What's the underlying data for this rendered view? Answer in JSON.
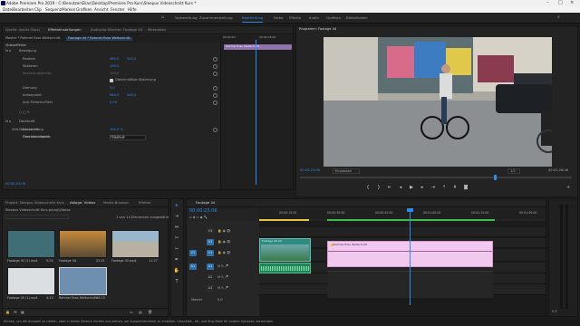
{
  "titlebar": {
    "title": "Adobe Premiere Pro 2019 - C:\\Benutzer\\Elias\\Desktop\\Premiere Pro Kurs\\Sleepus Videoschnitt Kurs *"
  },
  "menu": [
    "Datei",
    "Bearbeiten",
    "Clip",
    "Sequenz",
    "Marken",
    "Grafiken",
    "Ansicht",
    "Fenster",
    "Hilfe"
  ],
  "workspaces": [
    {
      "label": "Vorbereitung",
      "active": false
    },
    {
      "label": "Zusammenstellung",
      "active": false
    },
    {
      "label": "Bearbeitung",
      "active": true
    },
    {
      "label": "Farbe",
      "active": false
    },
    {
      "label": "Effekte",
      "active": false
    },
    {
      "label": "Audio",
      "active": false
    },
    {
      "label": "Grafiken",
      "active": false
    },
    {
      "label": "Bibliotheken",
      "active": false
    }
  ],
  "source_panel": {
    "tabs": [
      "Quelle: (keine Clips)",
      "Effekteinstellungen",
      "Audioclip-Mischer: Footage 44",
      "Metadaten"
    ],
    "breadcrumb_master": "Master * Rahmel Esso Weltschnitt",
    "breadcrumb_clip": "Footage 44 * Rahmel Esso Weltschnitt",
    "section_video": "Videoeffekte",
    "clip_on_timeline": "Rahmel Esso Weltschnitt",
    "timecode_start": "00:00:00",
    "timecode_mid": "00:00:05:00",
    "props": [
      {
        "label": "Bewegung",
        "value": "",
        "value2": ""
      },
      {
        "label": "Position",
        "value": "960,0",
        "value2": "540,0"
      },
      {
        "label": "Skalieren",
        "value": "100,0",
        "value2": ""
      },
      {
        "label": "Skalierungsbreite",
        "value": "100,0",
        "value2": ""
      },
      {
        "label": "",
        "value": "Gleichmäßige Skalierung",
        "value2": ""
      },
      {
        "label": "Drehung",
        "value": "0,0",
        "value2": ""
      },
      {
        "label": "Ankerpunkt",
        "value": "960,0",
        "value2": "540,0"
      },
      {
        "label": "Anti-Flimmer-Filter",
        "value": "0,00",
        "value2": ""
      }
    ],
    "opacity_section": "Deckkraft",
    "opacity_props": [
      {
        "label": "Deckkraft",
        "value": "100,0 %"
      },
      {
        "label": "Überblendmodus",
        "value": "Normal"
      }
    ],
    "time_remap": "Zeit-Neuzuordnung",
    "speed_label": "Geschwindigkeit",
    "speed_value": "100,00 %",
    "bottom_timecode": "00:00:23:06"
  },
  "program": {
    "title": "Programm: Footage 44",
    "timecode": "00:00:23:06",
    "fit": "Einpassen",
    "quality": "1/2",
    "duration": "00:01:28:08"
  },
  "project": {
    "tabs": [
      "Projekt: Sleepus Videoschnitt Kurs",
      "Ablage: Videos",
      "Media-Browser",
      "Effekte"
    ],
    "path": "Sleepus Videoschnitt Kurs.prproj\\Videos",
    "count": "1 von 14 Elementen ausgewählt",
    "items": [
      {
        "name": "Footage 43 (1).mp4",
        "duration": "5:24"
      },
      {
        "name": "Footage 44",
        "duration": "22:21"
      },
      {
        "name": "Footage 45.mp4",
        "duration": "11:27"
      },
      {
        "name": "Footage 45 (1).mp4",
        "duration": "4:13"
      },
      {
        "name": "Rahmel Esso Weltschnitt",
        "duration": "44:13"
      }
    ]
  },
  "timeline": {
    "tab": "Footage 44",
    "timecode": "00:00:23:06",
    "ruler": [
      "00:00:15:00",
      "00:00:30:00",
      "00:00:45:00",
      "00:01:00:00",
      "00:01:15:00",
      "00:01:30:00"
    ],
    "tracks": [
      "V3",
      "V2",
      "V1",
      "A1",
      "A2",
      "A3"
    ],
    "master": "Master",
    "master_value": "0,0",
    "clip_v1": "Footage 44 [V]",
    "clip_v2": "Rahmel Esso Weltschnitt"
  },
  "status": "Klicken, um die Auswahl zu treffen, oder in leeren Bereich klicken und ziehen, um Auswahlrechteck zu erstellen. Umschalt-, Alt- und Strg-Taste für andere Optionen verwenden.",
  "colors": {
    "accent": "#2d8ceb",
    "clip_pink": "#f1c9ef",
    "clip_teal": "#2f8b80"
  }
}
